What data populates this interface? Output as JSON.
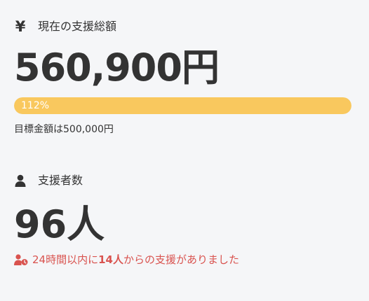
{
  "funding": {
    "icon": "yen-icon",
    "icon_glyph": "¥",
    "title": "現在の支援総額",
    "amount": "560,900",
    "amount_unit": "円",
    "progress_percent": 112,
    "progress_label": "112%",
    "progress_color": "#f9c85e",
    "goal_text": "目標金額は500,000円"
  },
  "supporters": {
    "icon": "user-icon",
    "title": "支援者数",
    "count": "96",
    "count_unit": "人",
    "recent_icon": "user-clock-icon",
    "recent_prefix": "24時間以内に",
    "recent_count": "14人",
    "recent_suffix": "からの支援がありました",
    "recent_color": "#d9534f"
  }
}
